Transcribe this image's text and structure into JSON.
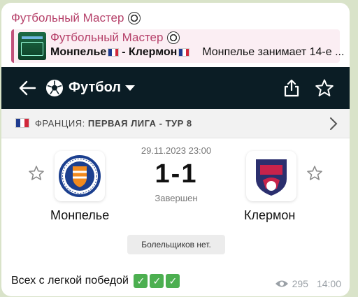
{
  "message": {
    "sender": "Футбольный Мастер",
    "caption": "Всех с легкой победой",
    "views": "295",
    "time": "14:00"
  },
  "reply": {
    "title": "Футбольный Мастер",
    "home": "Монпелье",
    "away": "Клермон",
    "separator": "-",
    "preview": "Монпелье занимает 14-е ..."
  },
  "app": {
    "sport_label": "Футбол",
    "league_country": "ФРАНЦИЯ:",
    "league_name": "ПЕРВАЯ ЛИГА - ТУР 8"
  },
  "match": {
    "datetime": "29.11.2023 23:00",
    "score": "1-1",
    "status": "Завершен",
    "home_team": "Монпелье",
    "away_team": "Клермон",
    "fans_label": "Болельщиков нет."
  },
  "colors": {
    "channel_accent": "#b6416a",
    "topbar": "#0b1d25",
    "check_green": "#4caf50",
    "france_blue": "#1f3b8f",
    "france_red": "#d1283b"
  }
}
